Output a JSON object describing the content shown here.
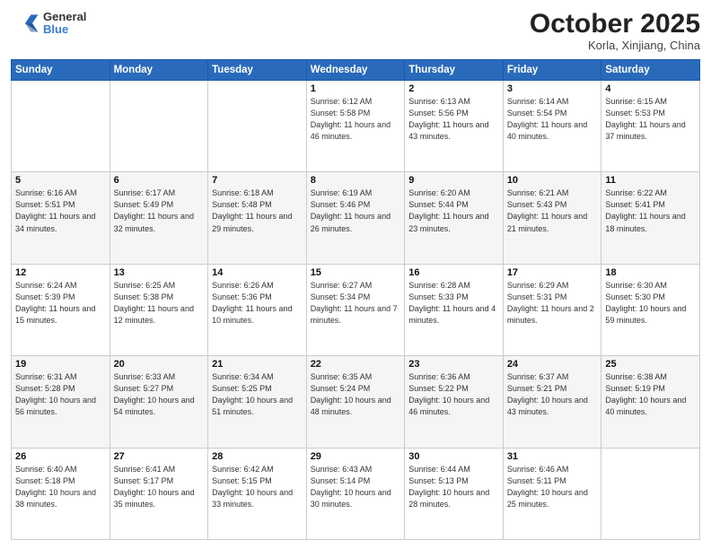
{
  "header": {
    "logo_line1": "General",
    "logo_line2": "Blue",
    "title": "October 2025",
    "subtitle": "Korla, Xinjiang, China"
  },
  "weekdays": [
    "Sunday",
    "Monday",
    "Tuesday",
    "Wednesday",
    "Thursday",
    "Friday",
    "Saturday"
  ],
  "weeks": [
    [
      {
        "day": "",
        "sunrise": "",
        "sunset": "",
        "daylight": ""
      },
      {
        "day": "",
        "sunrise": "",
        "sunset": "",
        "daylight": ""
      },
      {
        "day": "",
        "sunrise": "",
        "sunset": "",
        "daylight": ""
      },
      {
        "day": "1",
        "sunrise": "Sunrise: 6:12 AM",
        "sunset": "Sunset: 5:58 PM",
        "daylight": "Daylight: 11 hours and 46 minutes."
      },
      {
        "day": "2",
        "sunrise": "Sunrise: 6:13 AM",
        "sunset": "Sunset: 5:56 PM",
        "daylight": "Daylight: 11 hours and 43 minutes."
      },
      {
        "day": "3",
        "sunrise": "Sunrise: 6:14 AM",
        "sunset": "Sunset: 5:54 PM",
        "daylight": "Daylight: 11 hours and 40 minutes."
      },
      {
        "day": "4",
        "sunrise": "Sunrise: 6:15 AM",
        "sunset": "Sunset: 5:53 PM",
        "daylight": "Daylight: 11 hours and 37 minutes."
      }
    ],
    [
      {
        "day": "5",
        "sunrise": "Sunrise: 6:16 AM",
        "sunset": "Sunset: 5:51 PM",
        "daylight": "Daylight: 11 hours and 34 minutes."
      },
      {
        "day": "6",
        "sunrise": "Sunrise: 6:17 AM",
        "sunset": "Sunset: 5:49 PM",
        "daylight": "Daylight: 11 hours and 32 minutes."
      },
      {
        "day": "7",
        "sunrise": "Sunrise: 6:18 AM",
        "sunset": "Sunset: 5:48 PM",
        "daylight": "Daylight: 11 hours and 29 minutes."
      },
      {
        "day": "8",
        "sunrise": "Sunrise: 6:19 AM",
        "sunset": "Sunset: 5:46 PM",
        "daylight": "Daylight: 11 hours and 26 minutes."
      },
      {
        "day": "9",
        "sunrise": "Sunrise: 6:20 AM",
        "sunset": "Sunset: 5:44 PM",
        "daylight": "Daylight: 11 hours and 23 minutes."
      },
      {
        "day": "10",
        "sunrise": "Sunrise: 6:21 AM",
        "sunset": "Sunset: 5:43 PM",
        "daylight": "Daylight: 11 hours and 21 minutes."
      },
      {
        "day": "11",
        "sunrise": "Sunrise: 6:22 AM",
        "sunset": "Sunset: 5:41 PM",
        "daylight": "Daylight: 11 hours and 18 minutes."
      }
    ],
    [
      {
        "day": "12",
        "sunrise": "Sunrise: 6:24 AM",
        "sunset": "Sunset: 5:39 PM",
        "daylight": "Daylight: 11 hours and 15 minutes."
      },
      {
        "day": "13",
        "sunrise": "Sunrise: 6:25 AM",
        "sunset": "Sunset: 5:38 PM",
        "daylight": "Daylight: 11 hours and 12 minutes."
      },
      {
        "day": "14",
        "sunrise": "Sunrise: 6:26 AM",
        "sunset": "Sunset: 5:36 PM",
        "daylight": "Daylight: 11 hours and 10 minutes."
      },
      {
        "day": "15",
        "sunrise": "Sunrise: 6:27 AM",
        "sunset": "Sunset: 5:34 PM",
        "daylight": "Daylight: 11 hours and 7 minutes."
      },
      {
        "day": "16",
        "sunrise": "Sunrise: 6:28 AM",
        "sunset": "Sunset: 5:33 PM",
        "daylight": "Daylight: 11 hours and 4 minutes."
      },
      {
        "day": "17",
        "sunrise": "Sunrise: 6:29 AM",
        "sunset": "Sunset: 5:31 PM",
        "daylight": "Daylight: 11 hours and 2 minutes."
      },
      {
        "day": "18",
        "sunrise": "Sunrise: 6:30 AM",
        "sunset": "Sunset: 5:30 PM",
        "daylight": "Daylight: 10 hours and 59 minutes."
      }
    ],
    [
      {
        "day": "19",
        "sunrise": "Sunrise: 6:31 AM",
        "sunset": "Sunset: 5:28 PM",
        "daylight": "Daylight: 10 hours and 56 minutes."
      },
      {
        "day": "20",
        "sunrise": "Sunrise: 6:33 AM",
        "sunset": "Sunset: 5:27 PM",
        "daylight": "Daylight: 10 hours and 54 minutes."
      },
      {
        "day": "21",
        "sunrise": "Sunrise: 6:34 AM",
        "sunset": "Sunset: 5:25 PM",
        "daylight": "Daylight: 10 hours and 51 minutes."
      },
      {
        "day": "22",
        "sunrise": "Sunrise: 6:35 AM",
        "sunset": "Sunset: 5:24 PM",
        "daylight": "Daylight: 10 hours and 48 minutes."
      },
      {
        "day": "23",
        "sunrise": "Sunrise: 6:36 AM",
        "sunset": "Sunset: 5:22 PM",
        "daylight": "Daylight: 10 hours and 46 minutes."
      },
      {
        "day": "24",
        "sunrise": "Sunrise: 6:37 AM",
        "sunset": "Sunset: 5:21 PM",
        "daylight": "Daylight: 10 hours and 43 minutes."
      },
      {
        "day": "25",
        "sunrise": "Sunrise: 6:38 AM",
        "sunset": "Sunset: 5:19 PM",
        "daylight": "Daylight: 10 hours and 40 minutes."
      }
    ],
    [
      {
        "day": "26",
        "sunrise": "Sunrise: 6:40 AM",
        "sunset": "Sunset: 5:18 PM",
        "daylight": "Daylight: 10 hours and 38 minutes."
      },
      {
        "day": "27",
        "sunrise": "Sunrise: 6:41 AM",
        "sunset": "Sunset: 5:17 PM",
        "daylight": "Daylight: 10 hours and 35 minutes."
      },
      {
        "day": "28",
        "sunrise": "Sunrise: 6:42 AM",
        "sunset": "Sunset: 5:15 PM",
        "daylight": "Daylight: 10 hours and 33 minutes."
      },
      {
        "day": "29",
        "sunrise": "Sunrise: 6:43 AM",
        "sunset": "Sunset: 5:14 PM",
        "daylight": "Daylight: 10 hours and 30 minutes."
      },
      {
        "day": "30",
        "sunrise": "Sunrise: 6:44 AM",
        "sunset": "Sunset: 5:13 PM",
        "daylight": "Daylight: 10 hours and 28 minutes."
      },
      {
        "day": "31",
        "sunrise": "Sunrise: 6:46 AM",
        "sunset": "Sunset: 5:11 PM",
        "daylight": "Daylight: 10 hours and 25 minutes."
      },
      {
        "day": "",
        "sunrise": "",
        "sunset": "",
        "daylight": ""
      }
    ]
  ]
}
